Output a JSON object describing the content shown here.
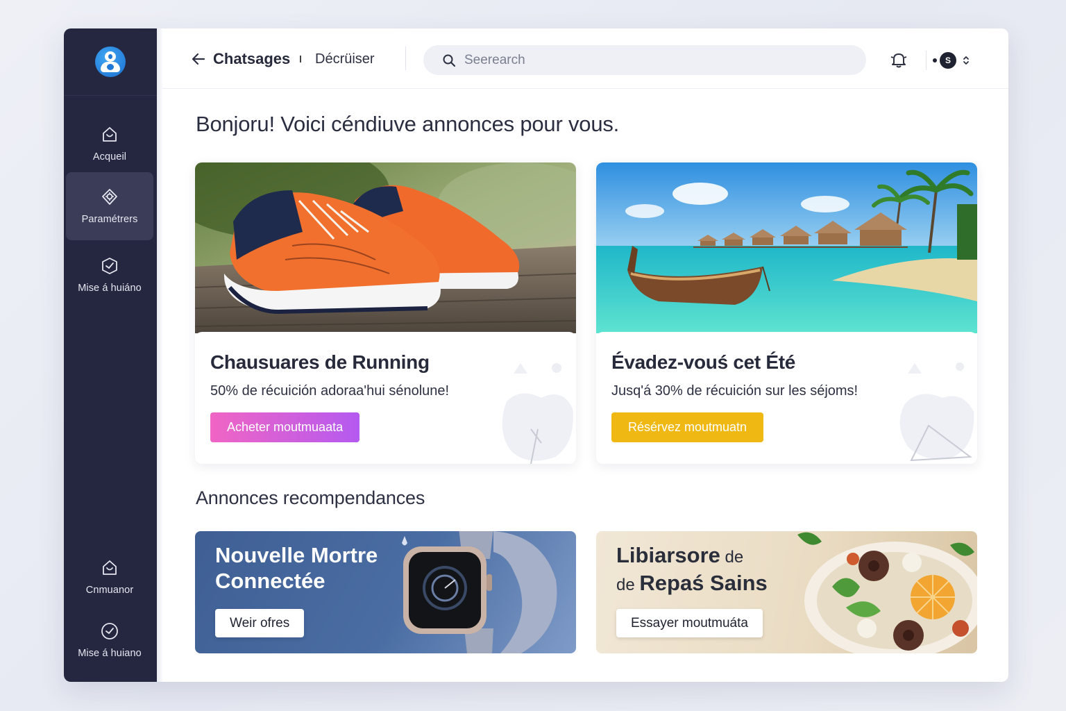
{
  "sidebar": {
    "items": [
      {
        "label": "Acqueil",
        "icon": "home-icon"
      },
      {
        "label": "Paramétrers",
        "icon": "settings-icon"
      },
      {
        "label": "Mise á huiáno",
        "icon": "update-icon"
      }
    ],
    "bottom_items": [
      {
        "label": "Cnmuanor",
        "icon": "home-icon"
      },
      {
        "label": "Mise á huiano",
        "icon": "update-icon"
      }
    ]
  },
  "header": {
    "breadcrumb_main": "Chatsages",
    "breadcrumb_sub": "Décrüiser",
    "search_placeholder": "Seerearch",
    "user_initial": "S"
  },
  "main": {
    "greeting": "Bonjoru! Voici céndiuve annonces pour vous.",
    "promos": [
      {
        "title": "Chausuares de Running",
        "description": "50% de récuición adoraa'hui sénolune!",
        "cta_label": "Acheter moutmuaata",
        "cta_color": "#e35fcf"
      },
      {
        "title": "Évadez-vouś cet Été",
        "description": "Jusq'á 30% de récuición sur les séjoms!",
        "cta_label": "Résérvez moutmuatn",
        "cta_color": "#f0b812"
      }
    ],
    "section_title": "Annonces recompendances",
    "recommended": [
      {
        "title_line1": "Nouvelle Mortre",
        "title_line2": "Connectée",
        "cta_label": "Weir ofres"
      },
      {
        "title_bold1": "Libiarsore",
        "title_light1": " de",
        "title_light2": "de ",
        "title_bold2": "Repaś Sains",
        "cta_label": "Essayer moutmuáta"
      }
    ]
  }
}
